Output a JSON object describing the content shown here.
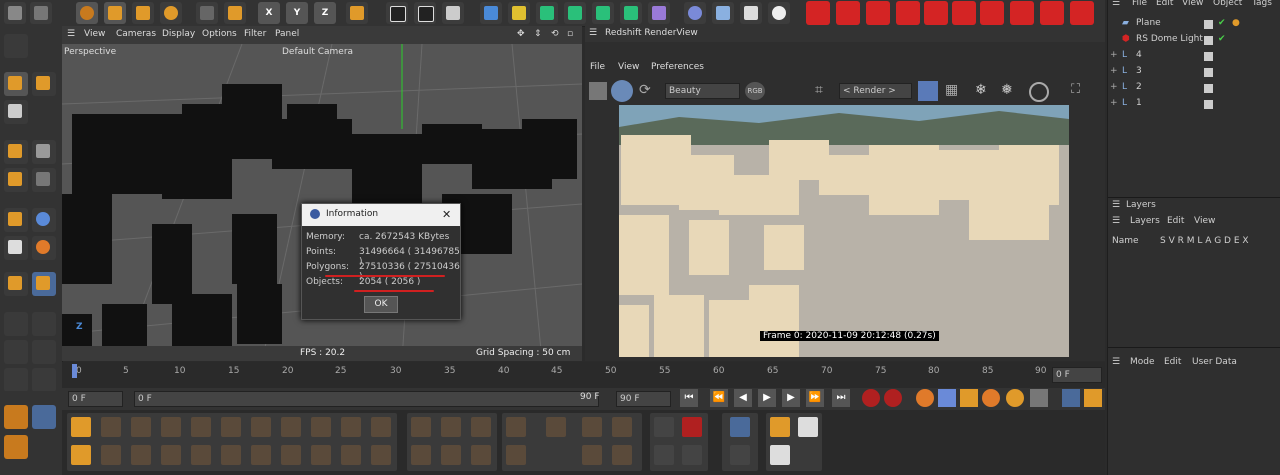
{
  "viewport": {
    "menu": [
      "View",
      "Cameras",
      "Display",
      "Options",
      "Filter",
      "Panel"
    ],
    "label": "Perspective",
    "camera": "Default Camera",
    "fps": "FPS : 20.2",
    "grid": "Grid Spacing : 50 cm",
    "axis": "Z"
  },
  "info_dialog": {
    "title": "Information",
    "rows": [
      {
        "label": "Memory:",
        "value": "ca. 2672543 KBytes"
      },
      {
        "label": "Points:",
        "value": "31496664 ( 31496785 )"
      },
      {
        "label": "Polygons:",
        "value": "27510336 ( 27510436 )"
      },
      {
        "label": "Objects:",
        "value": "2054 ( 2056 )"
      }
    ],
    "ok": "OK",
    "close": "✕"
  },
  "renderview": {
    "title": "Redshift RenderView",
    "menu": [
      "File",
      "View",
      "Preferences"
    ],
    "beauty": "Beauty",
    "rgb": "RGB",
    "render": "< Render >",
    "frame_text": "Frame  0:  2020-11-09  20:12:48  (0.27s)"
  },
  "object_manager": {
    "menu": [
      "File",
      "Edit",
      "View",
      "Object",
      "Tags"
    ],
    "items": [
      {
        "name": "Plane"
      },
      {
        "name": "RS Dome Light"
      },
      {
        "name": "4"
      },
      {
        "name": "3"
      },
      {
        "name": "2"
      },
      {
        "name": "1"
      }
    ]
  },
  "layers": {
    "title": "Layers",
    "menu": [
      "Layers",
      "Edit",
      "View"
    ],
    "columns": "Name",
    "flags": "S V R M L A G D E X"
  },
  "attributes": {
    "menu": [
      "Mode",
      "Edit",
      "User Data"
    ]
  },
  "timeline": {
    "ticks": [
      "0",
      "5",
      "10",
      "15",
      "20",
      "25",
      "30",
      "35",
      "40",
      "45",
      "50",
      "55",
      "60",
      "65",
      "70",
      "75",
      "80",
      "85",
      "90"
    ],
    "frame_field": "0 F"
  },
  "controls": {
    "start": "0 F",
    "current": "0 F",
    "end": "90 F",
    "max": "90 F"
  },
  "toolbar": {
    "axis_x": "X",
    "axis_y": "Y",
    "axis_z": "Z"
  }
}
